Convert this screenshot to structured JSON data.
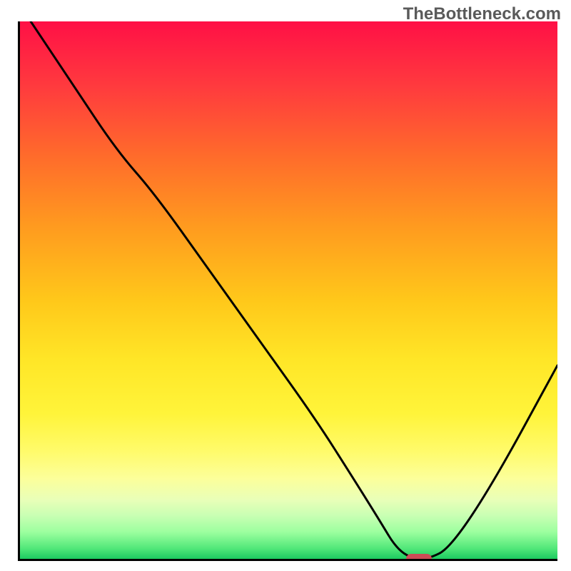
{
  "watermark": "TheBottleneck.com",
  "chart_data": {
    "type": "line",
    "title": "",
    "xlabel": "",
    "ylabel": "",
    "xlim": [
      0,
      100
    ],
    "ylim": [
      0,
      100
    ],
    "grid": false,
    "legend": false,
    "background_gradient": {
      "direction": "vertical",
      "stops": [
        {
          "pos": 0,
          "color": "#ff1046"
        },
        {
          "pos": 12,
          "color": "#ff3a3e"
        },
        {
          "pos": 25,
          "color": "#ff6b2b"
        },
        {
          "pos": 38,
          "color": "#ff9a1f"
        },
        {
          "pos": 52,
          "color": "#ffc81a"
        },
        {
          "pos": 63,
          "color": "#ffe627"
        },
        {
          "pos": 73,
          "color": "#fff43a"
        },
        {
          "pos": 80,
          "color": "#fffb6b"
        },
        {
          "pos": 85,
          "color": "#fcff9a"
        },
        {
          "pos": 89,
          "color": "#e9ffb8"
        },
        {
          "pos": 92,
          "color": "#c8ffb3"
        },
        {
          "pos": 95,
          "color": "#9cff9f"
        },
        {
          "pos": 98,
          "color": "#53e87a"
        },
        {
          "pos": 100,
          "color": "#1cca60"
        }
      ]
    },
    "series": [
      {
        "name": "bottleneck-curve",
        "color": "#000000",
        "x": [
          2,
          10,
          18,
          25,
          35,
          45,
          55,
          62,
          67,
          70,
          73,
          76,
          80,
          88,
          100
        ],
        "y": [
          100,
          88,
          76,
          68,
          54,
          40,
          26,
          15,
          7,
          2,
          0,
          0,
          2,
          14,
          36
        ]
      }
    ],
    "marker": {
      "x": 74,
      "y": 0,
      "color": "#cc4b56",
      "shape": "pill"
    }
  }
}
